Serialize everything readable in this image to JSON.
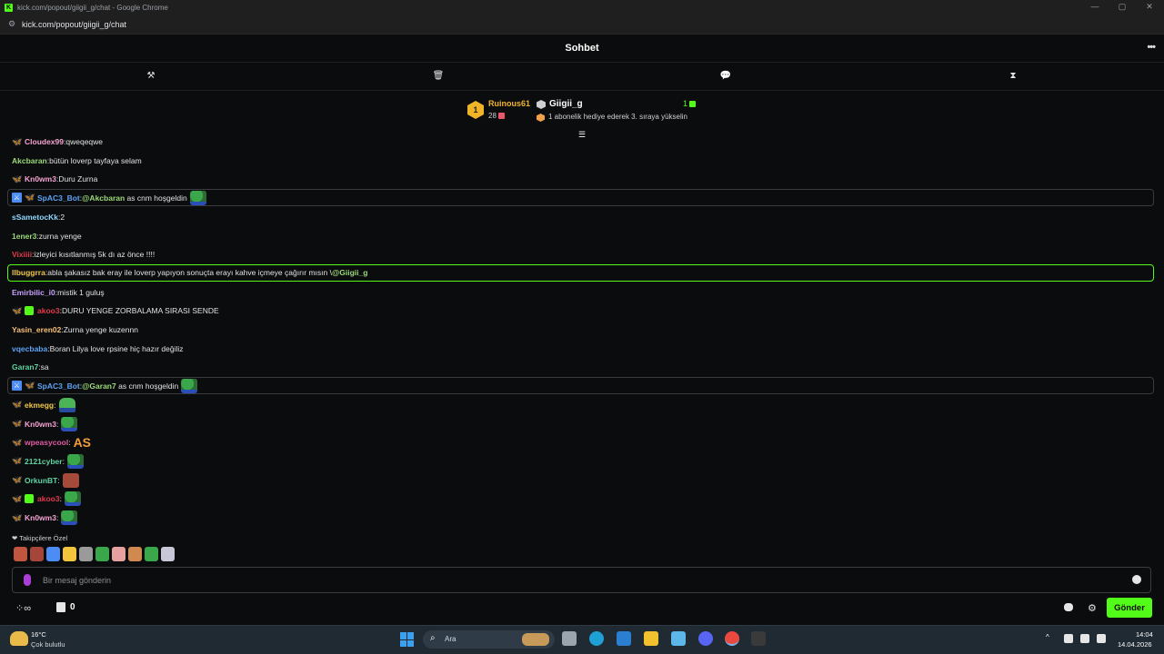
{
  "browser": {
    "window_title": "kick.com/popout/giigii_g/chat - Google Chrome",
    "url": "kick.com/popout/giigii_g/chat",
    "favicon_letter": "K"
  },
  "chat": {
    "title": "Sohbet",
    "more_label": "•••",
    "tools": [
      {
        "name": "hammer-icon",
        "glyph": "⚒"
      },
      {
        "name": "trash-icon",
        "glyph": "🗑"
      },
      {
        "name": "chat-bubble-icon",
        "glyph": "💬"
      },
      {
        "name": "hourglass-icon",
        "glyph": "⧗"
      }
    ]
  },
  "leaderboard": {
    "rank": "1",
    "top_user": "Ruinous61",
    "top_count": "28",
    "streamer": "Giigii_g",
    "streamer_count": "1",
    "hint": "1 abonelik hediye ederek 3. sıraya yükselin",
    "collapse_glyph": "☰"
  },
  "messages": [
    {
      "user": "Cloudex99",
      "color": "#f5a3d3",
      "text": "qweqeqwe",
      "badges": [
        "bf"
      ]
    },
    {
      "user": "Akcbaran",
      "color": "#9bd97a",
      "text": "bütün loverp tayfaya selam",
      "badges": []
    },
    {
      "user": "Kn0wm3",
      "color": "#f5a3d3",
      "text": "Duru Zurna",
      "badges": [
        "bf"
      ]
    },
    {
      "user": "SpAC3_Bot",
      "color": "#5da3f5",
      "mention": "@Akcbaran",
      "text": "as cnm hoşgeldin",
      "badges": [
        "mod",
        "bf"
      ],
      "highlight": "gray",
      "emote": "pepe"
    },
    {
      "user": "sSametocKk",
      "color": "#8fd7ff",
      "text": "2",
      "badges": []
    },
    {
      "user": "1ener3",
      "color": "#9bd97a",
      "text": "zurna yenge",
      "badges": []
    },
    {
      "user": "Vixiiii",
      "color": "#e23b4e",
      "text": "izleyici kısıtlanmış 5k dı az önce !!!!",
      "badges": []
    },
    {
      "user": "llbuggrra",
      "color": "#f0c84b",
      "text": "abla şakasız bak eray ile loverp yapıyon sonuçta erayı kahve içmeye çağırır mısın \\",
      "mention_after": "@Giigii_g",
      "badges": [],
      "highlight": "green"
    },
    {
      "user": "Emirbilic_i0",
      "color": "#c9a0ff",
      "text": "mistik 1 guluş",
      "badges": []
    },
    {
      "user": "akoo3",
      "color": "#e23b4e",
      "text": "DURU YENGE ZORBALAMA SIRASI SENDE",
      "badges": [
        "bf",
        "sub"
      ]
    },
    {
      "user": "Yasin_eren02",
      "color": "#f6c177",
      "text": "Zurna yenge kuzennn",
      "badges": []
    },
    {
      "user": "vqecbaba",
      "color": "#5da3f5",
      "text": "Boran Lilya love rpsine hiç hazır değiliz",
      "badges": []
    },
    {
      "user": "Garan7",
      "color": "#5fd4a4",
      "text": "sa",
      "badges": []
    },
    {
      "user": "SpAC3_Bot",
      "color": "#5da3f5",
      "mention": "@Garan7",
      "text": "as cnm hoşgeldin",
      "badges": [
        "mod",
        "bf"
      ],
      "highlight": "gray",
      "emote": "pepe"
    },
    {
      "user": "ekmegg",
      "color": "#f0c84b",
      "text": "",
      "badges": [
        "bf"
      ],
      "emote": "pepe2"
    },
    {
      "user": "Kn0wm3",
      "color": "#f5a3d3",
      "text": "",
      "badges": [
        "bf"
      ],
      "emote": "pepe"
    },
    {
      "user": "wpeasycool",
      "color": "#e25aa4",
      "text": "",
      "badges": [
        "bf"
      ],
      "emote": "as",
      "emote_text": "AS"
    },
    {
      "user": "2121cyber",
      "color": "#5fd4a4",
      "text": "",
      "badges": [
        "bf"
      ],
      "emote": "pepe"
    },
    {
      "user": "OrkunBT",
      "color": "#5fd4a4",
      "text": "",
      "badges": [
        "bf"
      ],
      "emote": "face"
    },
    {
      "user": "akoo3",
      "color": "#e23b4e",
      "text": "",
      "badges": [
        "bf",
        "sub"
      ],
      "emote": "pepe"
    },
    {
      "user": "Kn0wm3",
      "color": "#f5a3d3",
      "text": "",
      "badges": [
        "bf"
      ],
      "emote": "pepe"
    }
  ],
  "emote_panel": {
    "label": "❤ Takipçilere Özel",
    "emotes": [
      "#c0563f",
      "#a6453a",
      "#4b8cf5",
      "#f2c53d",
      "#9a9a9a",
      "#3aa84a",
      "#e6a0a0",
      "#d08a4f",
      "#3aa84a",
      "#c7c7d7"
    ]
  },
  "input": {
    "placeholder": "Bir mesaj gönderin",
    "value": ""
  },
  "footer": {
    "points_glyph": "⁘∞",
    "store_count": "0",
    "send_label": "Gönder"
  },
  "taskbar": {
    "temp": "16°C",
    "weather": "Çok bulutlu",
    "search_label": "Ara",
    "time": "14:04",
    "date": "14.04.2026",
    "apps": [
      {
        "name": "task-view-icon",
        "color": "#9ba5ae"
      },
      {
        "name": "edge-icon",
        "color": "#1fa1d6"
      },
      {
        "name": "store-icon",
        "color": "#2b7fd1"
      },
      {
        "name": "file-explorer-icon",
        "color": "#f2c12e"
      },
      {
        "name": "settings-app-icon",
        "color": "#5db7e8"
      },
      {
        "name": "discord-icon",
        "color": "#5865f2"
      },
      {
        "name": "chrome-icon",
        "color": "#e9493f"
      },
      {
        "name": "app-icon",
        "color": "#3a3a3a"
      }
    ]
  }
}
